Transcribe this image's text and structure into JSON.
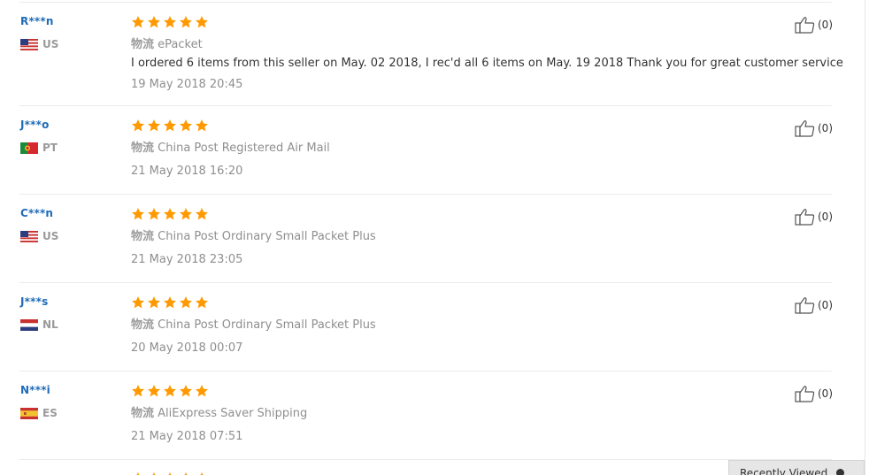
{
  "labels": {
    "logistics": "物流"
  },
  "colors": {
    "buyer_name": "#1e6bb8",
    "star": "#ff9900",
    "muted_text": "#8f8f8f",
    "body_text": "#333333",
    "divider": "#ececec"
  },
  "icons": {
    "rating_star": "star-icon",
    "helpful": "thumbs-up-icon"
  },
  "reviews": [
    {
      "buyer": "R***n",
      "country": "US",
      "rating": 5,
      "shipping": "ePacket",
      "text": "I ordered 6 items from this seller on May. 02 2018, I rec'd all 6 items on May. 19 2018 Thank you for great customer service",
      "date": "19 May 2018 20:45",
      "helpful_count": "(0)"
    },
    {
      "buyer": "J***o",
      "country": "PT",
      "rating": 5,
      "shipping": "China Post Registered Air Mail",
      "text": "",
      "date": "21 May 2018 16:20",
      "helpful_count": "(0)"
    },
    {
      "buyer": "C***n",
      "country": "US",
      "rating": 5,
      "shipping": "China Post Ordinary Small Packet Plus",
      "text": "",
      "date": "21 May 2018 23:05",
      "helpful_count": "(0)"
    },
    {
      "buyer": "J***s",
      "country": "NL",
      "rating": 5,
      "shipping": "China Post Ordinary Small Packet Plus",
      "text": "",
      "date": "20 May 2018 00:07",
      "helpful_count": "(0)"
    },
    {
      "buyer": "N***i",
      "country": "ES",
      "rating": 5,
      "shipping": "AliExpress Saver Shipping",
      "text": "",
      "date": "21 May 2018 07:51",
      "helpful_count": "(0)"
    }
  ],
  "partial_review": {
    "rating": 5
  },
  "floating_panel": {
    "label": "Recently Viewed"
  }
}
